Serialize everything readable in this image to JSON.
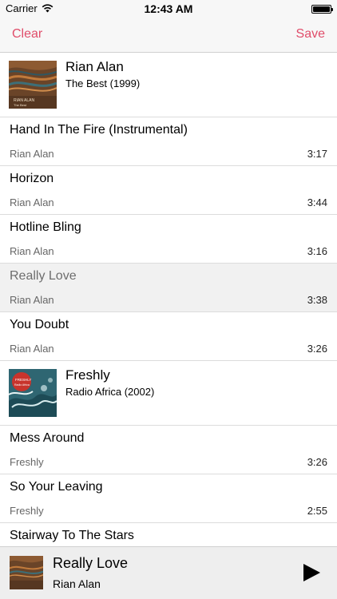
{
  "status_bar": {
    "carrier": "Carrier",
    "time": "12:43 AM"
  },
  "nav": {
    "clear_label": "Clear",
    "save_label": "Save"
  },
  "accent_color": "#e04d6a",
  "albums": [
    {
      "artist": "Rian Alan",
      "album": "The Best (1999)",
      "cover_text": "RIAN ALAN",
      "cover_subtext": "The Best",
      "tracks": [
        {
          "title": "Hand In The Fire (Instrumental)",
          "artist": "Rian Alan",
          "duration": "3:17",
          "selected": false
        },
        {
          "title": "Horizon",
          "artist": "Rian Alan",
          "duration": "3:44",
          "selected": false
        },
        {
          "title": "Hotline Bling",
          "artist": "Rian Alan",
          "duration": "3:16",
          "selected": false
        },
        {
          "title": "Really Love",
          "artist": "Rian Alan",
          "duration": "3:38",
          "selected": true
        },
        {
          "title": "You Doubt",
          "artist": "Rian Alan",
          "duration": "3:26",
          "selected": false
        }
      ]
    },
    {
      "artist": "Freshly",
      "album": "Radio Africa (2002)",
      "cover_text": "FRESHLY",
      "cover_subtext": "Radio Africa",
      "tracks": [
        {
          "title": "Mess Around",
          "artist": "Freshly",
          "duration": "3:26",
          "selected": false
        },
        {
          "title": "So Your Leaving",
          "artist": "Freshly",
          "duration": "2:55",
          "selected": false
        },
        {
          "title": "Stairway To The Stars",
          "artist": "",
          "duration": "",
          "selected": false
        }
      ]
    }
  ],
  "now_playing": {
    "title": "Really Love",
    "artist": "Rian Alan",
    "play_icon": "play-icon"
  }
}
